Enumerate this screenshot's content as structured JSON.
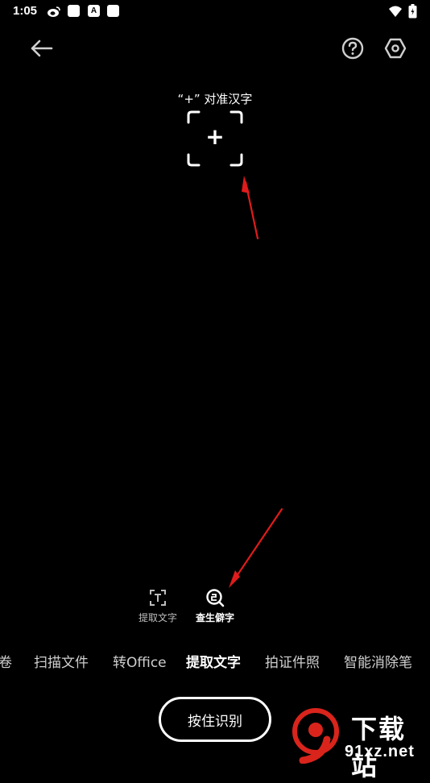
{
  "status_bar": {
    "time": "1:05",
    "icons": [
      "weibo-icon",
      "notification-icon",
      "a-icon",
      "notification-icon",
      "wifi-icon",
      "battery-icon"
    ],
    "a_glyph": "A"
  },
  "top_bar": {
    "back_icon": "arrow-left-icon",
    "help_icon": "question-circle-icon",
    "settings_icon": "hexagon-settings-icon"
  },
  "viewfinder": {
    "hint": "“+” 对准汉字",
    "center_glyph": "+"
  },
  "modes": [
    {
      "label": "提取文字",
      "icon": "text-extract-icon",
      "active": false
    },
    {
      "label": "查生僻字",
      "icon": "rare-char-search-icon",
      "active": true
    }
  ],
  "tabs": [
    {
      "label": "卷",
      "active": false
    },
    {
      "label": "扫描文件",
      "active": false
    },
    {
      "label": "转Office",
      "active": false
    },
    {
      "label": "提取文字",
      "active": true
    },
    {
      "label": "拍证件照",
      "active": false
    },
    {
      "label": "智能消除笔",
      "active": false
    }
  ],
  "shutter": {
    "label": "按住识别"
  },
  "watermark": {
    "title": "下载站",
    "url": "91xz.net",
    "logo_glyph": "9"
  },
  "colors": {
    "background": "#000000",
    "foreground": "#ffffff",
    "annotation_arrow": "#e01b1b",
    "watermark_red": "#d9241c"
  }
}
